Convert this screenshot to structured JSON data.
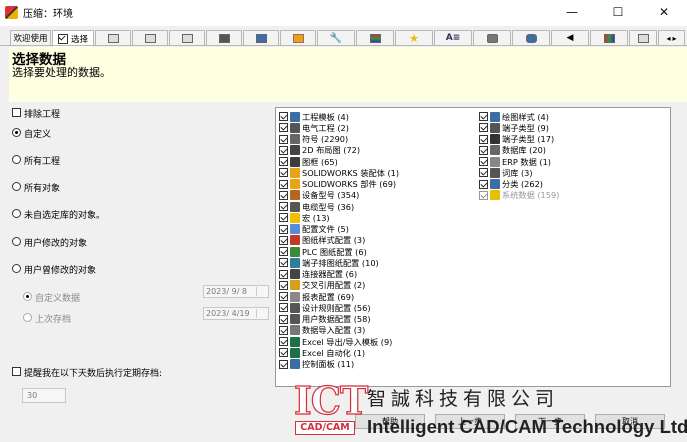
{
  "window": {
    "title": "压缩：环境",
    "minimize": "—",
    "maximize": "☐",
    "close": "✕"
  },
  "tabs": [
    {
      "label": "欢迎使用"
    },
    {
      "label": "选择",
      "checked": true
    }
  ],
  "tab_icons": [
    "edit-icon",
    "copy-icon",
    "printer-icon",
    "database-icon",
    "floppy-icon",
    "cube-icon",
    "wrench-icon",
    "book-icon",
    "star-icon",
    "text-icon",
    "cylinder-icon",
    "disk-stack-icon",
    "speaker-icon",
    "tree-icon",
    "grid-icon"
  ],
  "header": {
    "title": "选择数据",
    "subtitle": "选择要处理的数据。"
  },
  "left": {
    "exclude_projects": "排除工程",
    "radios": [
      "自定义",
      "所有工程",
      "所有对象",
      "未自选定库的对象。",
      "用户修改的对象",
      "用户曾修改的对象"
    ],
    "selected_radio": 0,
    "custom_data": "自定义数据",
    "last_archive": "上次存档",
    "date1": "2023/  9/  8",
    "date2": "2023/  4/19",
    "reminder": "提醒我在以下天数后执行定期存档:",
    "days": "30"
  },
  "list": {
    "col1": [
      {
        "label": "工程模板 (4)",
        "icon": "template-icon",
        "color": "#3a6ea5"
      },
      {
        "label": "电气工程 (2)",
        "icon": "electrical-icon",
        "color": "#555555"
      },
      {
        "label": "符号 (2290)",
        "icon": "symbol-icon",
        "color": "#666666"
      },
      {
        "label": "2D 布局图 (72)",
        "icon": "layout-icon",
        "color": "#444444"
      },
      {
        "label": "图框 (65)",
        "icon": "frame-icon",
        "color": "#3d3d3d"
      },
      {
        "label": "SOLIDWORKS 装配体 (1)",
        "icon": "solidworks-assembly-icon",
        "color": "#e8a317"
      },
      {
        "label": "SOLIDWORKS 部件 (69)",
        "icon": "solidworks-part-icon",
        "color": "#e8a317"
      },
      {
        "label": "设备型号 (354)",
        "icon": "pen-icon",
        "color": "#b5651d"
      },
      {
        "label": "电缆型号 (36)",
        "icon": "cable-icon",
        "color": "#555555"
      },
      {
        "label": "宏 (13)",
        "icon": "star-icon",
        "color": "#f0c000"
      },
      {
        "label": "配置文件 (5)",
        "icon": "config-icon",
        "color": "#5a8bd6"
      },
      {
        "label": "图纸样式配置 (3)",
        "icon": "drawing-style-icon",
        "color": "#c0392b"
      },
      {
        "label": "PLC 图纸配置 (6)",
        "icon": "plc-icon",
        "color": "#3a8a3a"
      },
      {
        "label": "端子排图纸配置 (10)",
        "icon": "terminal-strip-icon",
        "color": "#2e7d9a"
      },
      {
        "label": "连接器配置 (6)",
        "icon": "connector-icon",
        "color": "#444444"
      },
      {
        "label": "交叉引用配置 (2)",
        "icon": "cross-reference-icon",
        "color": "#d4a017"
      },
      {
        "label": "报表配置 (69)",
        "icon": "report-icon",
        "color": "#888888"
      },
      {
        "label": "设计规则配置 (56)",
        "icon": "design-rule-icon",
        "color": "#555555"
      },
      {
        "label": "用户数据配置 (58)",
        "icon": "user-data-icon",
        "color": "#555555"
      },
      {
        "label": "数据导入配置 (3)",
        "icon": "import-icon",
        "color": "#777777"
      },
      {
        "label": "Excel 导出/导入模板 (9)",
        "icon": "excel-icon",
        "color": "#1e7145"
      },
      {
        "label": "Excel 自动化 (1)",
        "icon": "excel-automation-icon",
        "color": "#1e7145"
      },
      {
        "label": "控制面板 (11)",
        "icon": "control-panel-icon",
        "color": "#3a6ea5"
      }
    ],
    "col2": [
      {
        "label": "绘图样式 (4)",
        "icon": "drawing-icon",
        "color": "#3a6ea5"
      },
      {
        "label": "端子类型 (9)",
        "icon": "terminal-icon",
        "color": "#555555"
      },
      {
        "label": "端子类型 (17)",
        "icon": "terminal-type-icon",
        "color": "#333333"
      },
      {
        "label": "数据库 (20)",
        "icon": "database-icon",
        "color": "#666666"
      },
      {
        "label": "ERP 数据 (1)",
        "icon": "erp-icon",
        "color": "#888888"
      },
      {
        "label": "词库 (3)",
        "icon": "dictionary-icon",
        "color": "#555555"
      },
      {
        "label": "分类 (262)",
        "icon": "classification-icon",
        "color": "#3a6ea5"
      },
      {
        "label": "系统数据 (159)",
        "icon": "system-data-icon",
        "color": "#e8c000",
        "grey": true
      }
    ]
  },
  "buttons": [
    "帮助",
    "上一步",
    "下一步",
    "取消"
  ],
  "watermark": {
    "logo": "ICT",
    "badge": "CAD/CAM",
    "cn": "智誠科技有限公司",
    "en": "Intelligent CAD/CAM Technology Ltd."
  }
}
